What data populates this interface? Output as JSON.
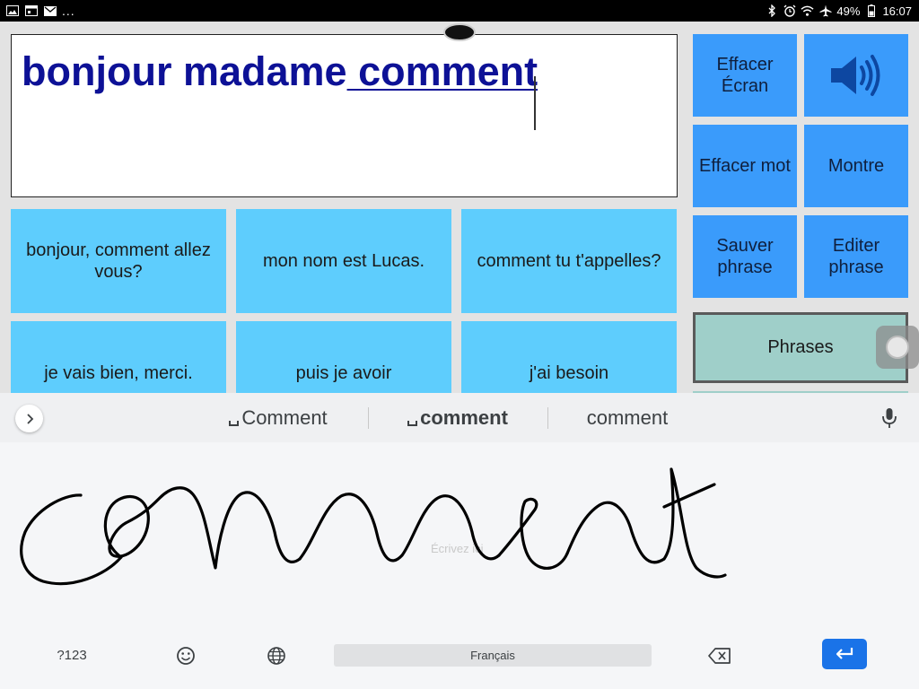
{
  "status_bar": {
    "left_icons": [
      "image-icon",
      "calendar-icon",
      "mail-icon"
    ],
    "more": "...",
    "right_icons": [
      "bluetooth-icon",
      "alarm-icon",
      "wifi-icon",
      "airplane-icon"
    ],
    "battery": "49%",
    "time": "16:07"
  },
  "text_display": {
    "typed_plain": "bonjour madame",
    "typed_underlined": " comment"
  },
  "phrases": [
    {
      "label": "bonjour, comment allez vous?"
    },
    {
      "label": "mon nom est Lucas."
    },
    {
      "label": "comment tu t'appelles?"
    },
    {
      "label": "je vais bien, merci."
    },
    {
      "label": "puis je avoir"
    },
    {
      "label": "j'ai besoin"
    }
  ],
  "controls": {
    "clear_screen": "Effacer Écran",
    "speak_icon": "speaker-icon",
    "clear_word": "Effacer mot",
    "show": "Montre",
    "save_phrase": "Sauver phrase",
    "edit_phrase": "Editer phrase",
    "phrases": "Phrases"
  },
  "keyboard": {
    "suggestions": [
      "Comment",
      "comment",
      "comment"
    ],
    "handwriting_placeholder": "Écrivez ici",
    "handwriting_text": "comment",
    "symbols_key": "?123",
    "language": "Français",
    "accent": "#1a73e8"
  }
}
